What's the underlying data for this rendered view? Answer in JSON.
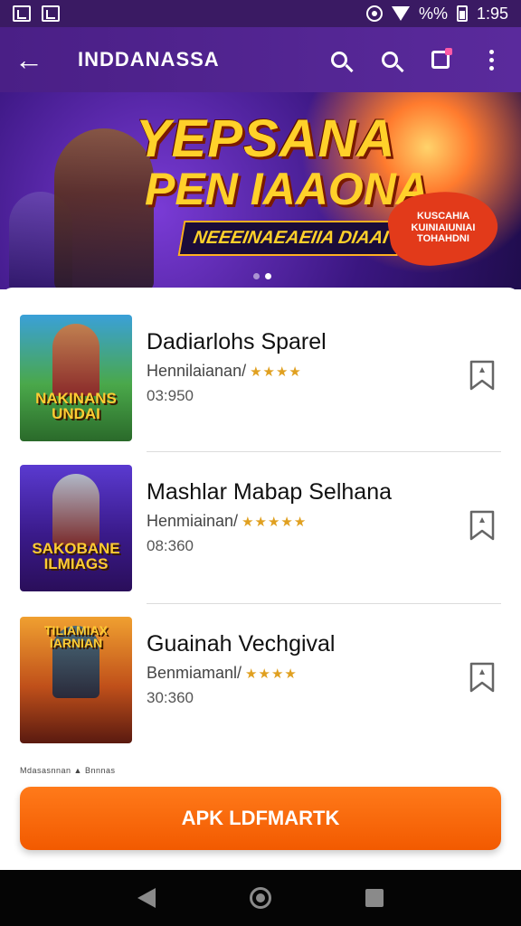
{
  "status_bar": {
    "time": "1:95",
    "battery_text": "%%"
  },
  "app_bar": {
    "title": "INDDANASSA"
  },
  "banner": {
    "title_line1": "YEPSANA",
    "title_line2": "PEN IAAONA",
    "subtitle": "NEEEINAEAEIIA DIAAI",
    "splash_text": "KUSCAHIA KUINIAIUNIAI TOHAHDNI"
  },
  "apps": [
    {
      "name": "Dadiarlohs Sparel",
      "category": "Hennilaianan/",
      "stars": "★★★★",
      "size": "03:950",
      "thumb_label": "NAKINANS UNDAI"
    },
    {
      "name": "Mashlar Mabap Selhana",
      "category": "Henmiainan/",
      "stars": "★★★★★",
      "size": "08:360",
      "thumb_label": "SAKOBANE ILMIAGS"
    },
    {
      "name": "Guainah Vechgival",
      "category": "Benmiamanl/",
      "stars": "★★★★",
      "size": "30:360",
      "thumb_label": "TILIAMIAX IARNIAN"
    }
  ],
  "footer_tiny": "Mdasasnnan  ▲  Bnnnas",
  "cta": {
    "label": "APK LDFMARTK"
  },
  "colors": {
    "app_bar": "#4a1f86",
    "cta": "#f46a0c",
    "star": "#e0a020"
  }
}
